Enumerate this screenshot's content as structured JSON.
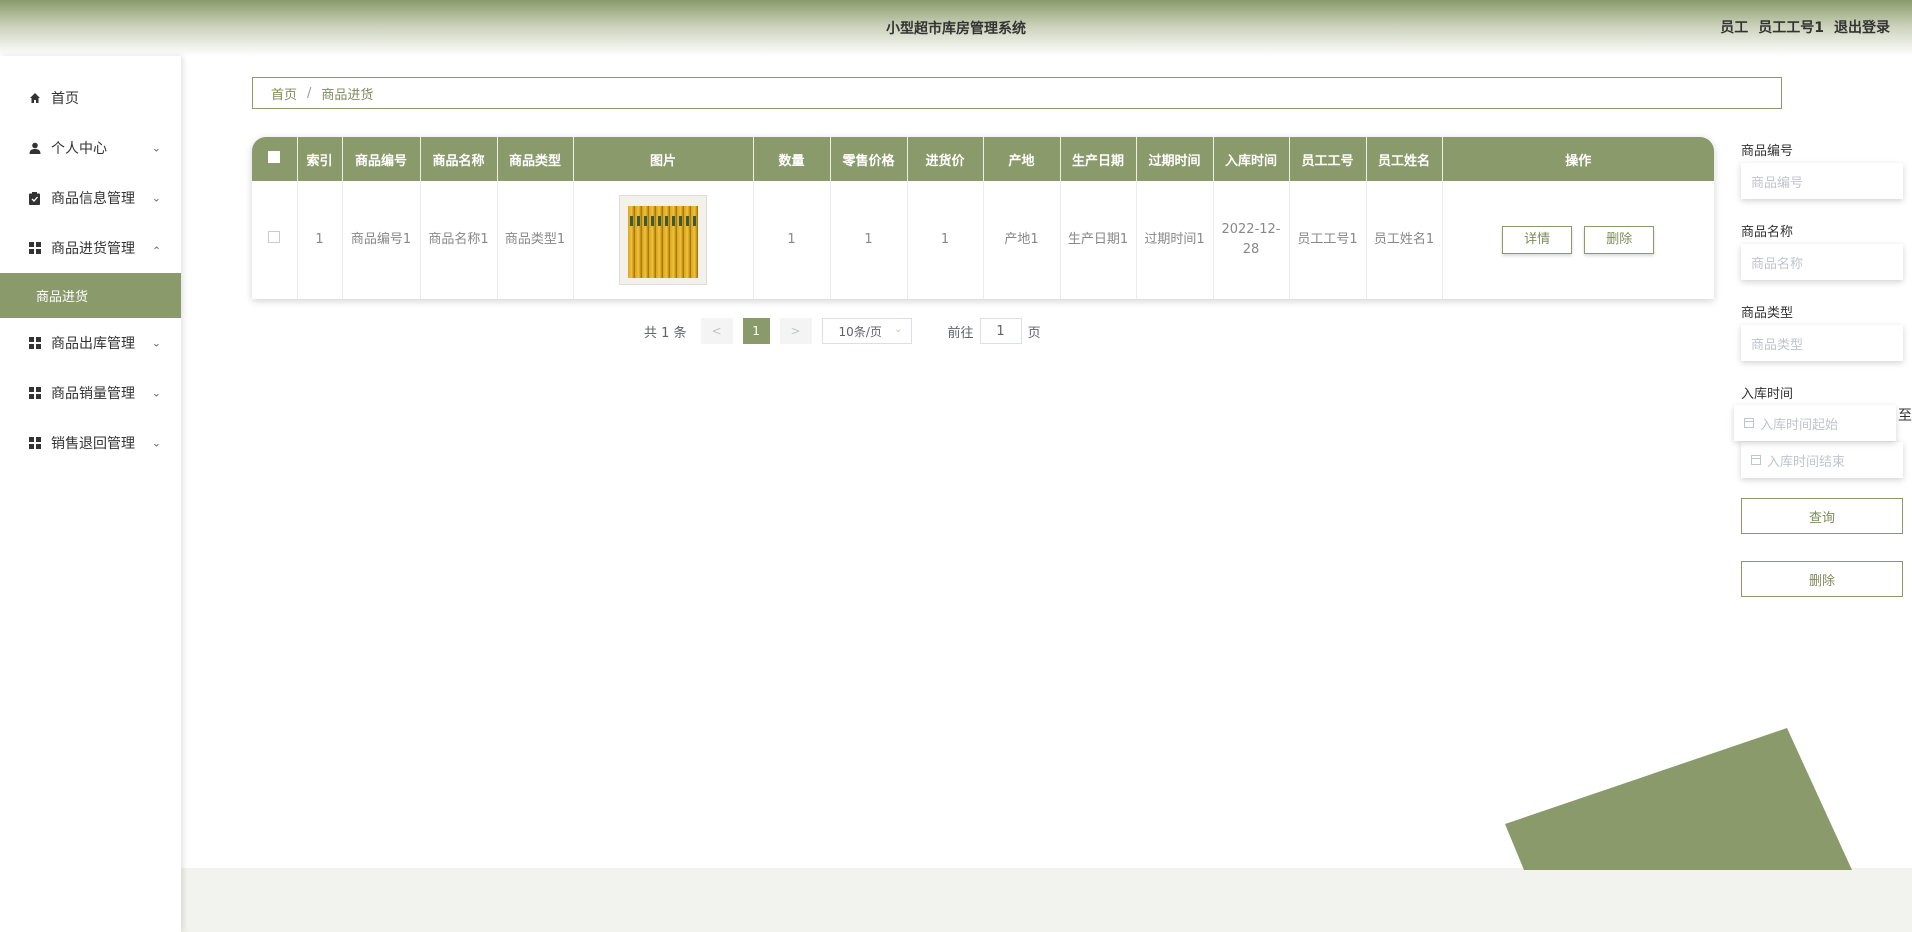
{
  "header": {
    "title": "小型超市库房管理系统",
    "role": "员工",
    "username": "员工工号1",
    "logout": "退出登录"
  },
  "sidebar": {
    "items": [
      {
        "label": "首页"
      },
      {
        "label": "个人中心"
      },
      {
        "label": "商品信息管理"
      },
      {
        "label": "商品进货管理",
        "expanded": true,
        "children": [
          {
            "label": "商品进货",
            "active": true
          }
        ]
      },
      {
        "label": "商品出库管理"
      },
      {
        "label": "商品销量管理"
      },
      {
        "label": "销售退回管理"
      }
    ]
  },
  "breadcrumb": {
    "home": "首页",
    "separator": "/",
    "current": "商品进货"
  },
  "table": {
    "columns": [
      "索引",
      "商品编号",
      "商品名称",
      "商品类型",
      "图片",
      "数量",
      "零售价格",
      "进货价",
      "产地",
      "生产日期",
      "过期时间",
      "入库时间",
      "员工工号",
      "员工姓名",
      "操作"
    ],
    "rows": [
      {
        "index": "1",
        "code": "商品编号1",
        "name": "商品名称1",
        "type": "商品类型1",
        "qty": "1",
        "retail": "1",
        "cost": "1",
        "origin": "产地1",
        "produced": "生产日期1",
        "expire": "过期时间1",
        "stocked": "2022-12-28",
        "emp_no": "员工工号1",
        "emp_name": "员工姓名1",
        "actions": {
          "detail": "详情",
          "delete": "删除"
        }
      }
    ]
  },
  "pagination": {
    "total": "共 1 条",
    "prev": "<",
    "page": "1",
    "next": ">",
    "page_size": "10条/页",
    "goto": "前往",
    "goto_value": "1",
    "page_unit": "页"
  },
  "search": {
    "code_label": "商品编号",
    "code_placeholder": "商品编号",
    "name_label": "商品名称",
    "name_placeholder": "商品名称",
    "type_label": "商品类型",
    "type_placeholder": "商品类型",
    "time_label": "入库时间",
    "time_start": "入库时间起始",
    "to": "至",
    "time_end": "入库时间结束",
    "query_button": "查询",
    "delete_button": "删除"
  },
  "colors": {
    "accent": "#8a9a6a",
    "accent_text": "#7d8c5c"
  }
}
